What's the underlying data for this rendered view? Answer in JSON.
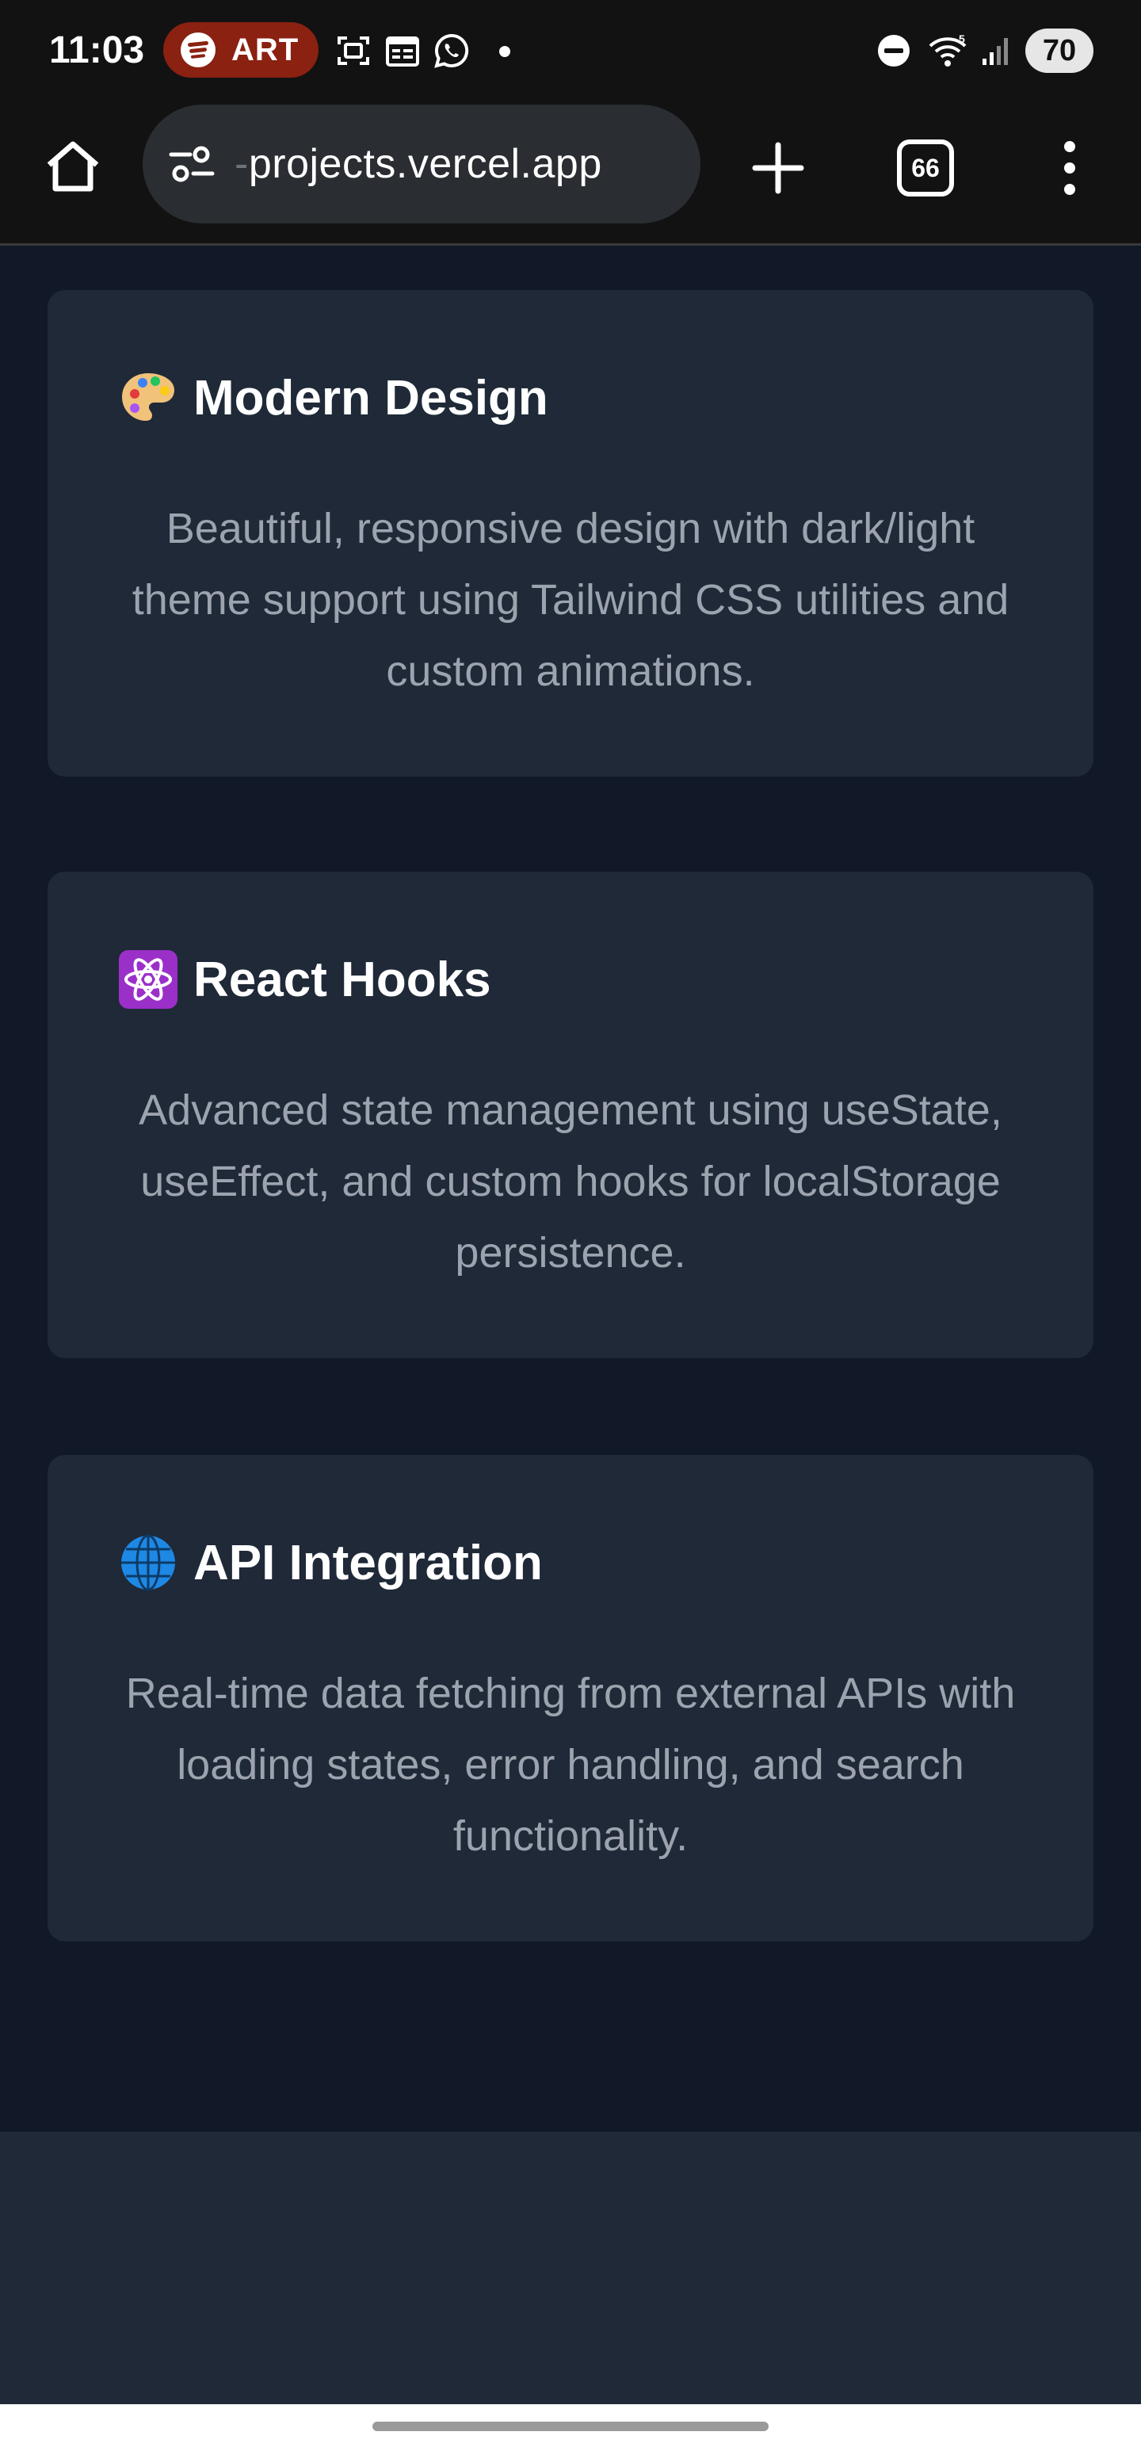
{
  "status_bar": {
    "time": "11:03",
    "spotify_label": "ART",
    "battery": "70",
    "icons": [
      "spotify-icon",
      "screenshot-icon",
      "calendar-icon",
      "whatsapp-icon",
      "notification-dot-icon",
      "do-not-disturb-icon",
      "wifi-icon",
      "signal-icon",
      "battery-icon"
    ]
  },
  "browser": {
    "url_faded": "-",
    "url": "projects.vercel.app",
    "tab_count": "66",
    "icons": [
      "home-icon",
      "site-settings-icon",
      "new-tab-icon",
      "tab-switcher-icon",
      "overflow-menu-icon"
    ]
  },
  "cards": [
    {
      "emoji_icon": "artist-palette-icon",
      "title": "Modern Design",
      "description": "Beautiful, responsive design with dark/light theme support using Tailwind CSS utilities and custom animations."
    },
    {
      "emoji_icon": "atom-symbol-icon",
      "title": "React Hooks",
      "description": "Advanced state management using useState, useEffect, and custom hooks for localStorage persistence."
    },
    {
      "emoji_icon": "globe-icon",
      "title": "API Integration",
      "description": "Real-time data fetching from external APIs with loading states, error handling, and search functionality."
    }
  ],
  "colors": {
    "page_bg": "#111827",
    "card_bg": "#1f2937",
    "title": "#ffffff",
    "description": "#9ca3af",
    "browser_bg": "#121212",
    "url_pill": "#2a2d31",
    "spotify_pill": "#8a2111"
  }
}
